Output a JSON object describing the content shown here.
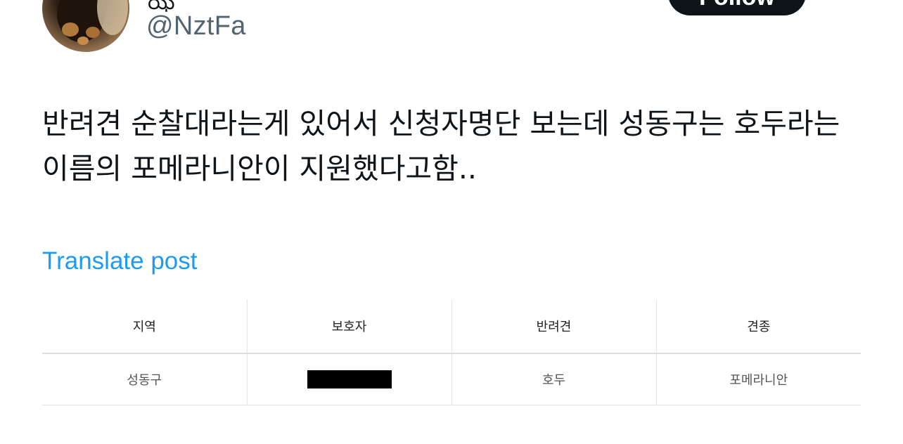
{
  "author": {
    "handle": "@NztFa",
    "avatar_icon": "user-avatar-photo",
    "display_name_partial": "ఝ"
  },
  "follow_button": {
    "label": "Follow"
  },
  "tweet": {
    "text": "반려견 순찰대라는게 있어서 신청자명단 보는데 성동구는 호두라는 이름의 포메라니안이 지원했다고함..",
    "translate_label": "Translate post"
  },
  "media_table": {
    "headers": [
      "지역",
      "보호자",
      "반려견",
      "견종"
    ],
    "rows": [
      {
        "region": "성동구",
        "guardian": "",
        "guardian_redacted": true,
        "dog": "호두",
        "breed": "포메라니안"
      }
    ]
  },
  "colors": {
    "link": "#1d9bf0",
    "handle": "#536471",
    "text": "#0f1419",
    "button_bg": "#0f1419"
  }
}
